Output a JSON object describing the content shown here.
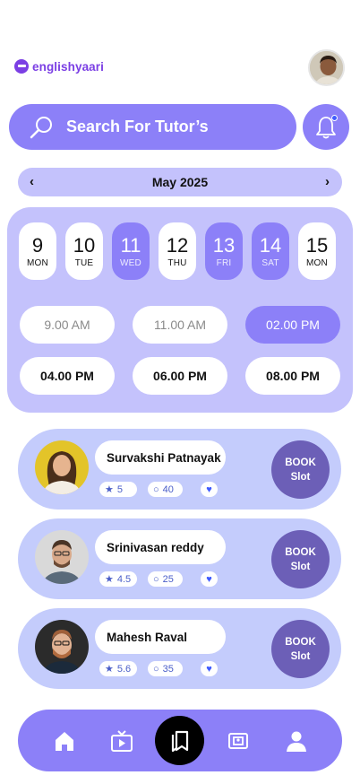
{
  "brand": {
    "name": "englishyaari",
    "color": "#7b3fe4"
  },
  "header": {
    "avatar_icon": "user-avatar"
  },
  "search": {
    "label": "Search For Tutor’s",
    "icon": "search-icon"
  },
  "notifications": {
    "icon": "bell-icon",
    "has_unread": true
  },
  "calendar": {
    "month": "May 2025",
    "prev_icon": "chevron-left-icon",
    "next_icon": "chevron-right-icon",
    "days": [
      {
        "num": "9",
        "name": "MON",
        "selected": false
      },
      {
        "num": "10",
        "name": "TUE",
        "selected": false
      },
      {
        "num": "11",
        "name": "WED",
        "selected": true
      },
      {
        "num": "12",
        "name": "THU",
        "selected": false
      },
      {
        "num": "13",
        "name": "FRI",
        "selected": true
      },
      {
        "num": "14",
        "name": "SAT",
        "selected": true
      },
      {
        "num": "15",
        "name": "MON",
        "selected": false
      }
    ],
    "times": [
      {
        "label": "9.00 AM",
        "state": "muted"
      },
      {
        "label": "11.00 AM",
        "state": "muted"
      },
      {
        "label": "02.00 PM",
        "state": "active"
      },
      {
        "label": "04.00 PM",
        "state": "normal"
      },
      {
        "label": "06.00 PM",
        "state": "normal"
      },
      {
        "label": "08.00 PM",
        "state": "normal"
      }
    ]
  },
  "tutors": [
    {
      "name": "Survakshi Patnayak",
      "rating": "5",
      "reviews": "40",
      "book_line1": "BOOK",
      "book_line2": "Slot"
    },
    {
      "name": "Srinivasan reddy",
      "rating": "4.5",
      "reviews": "25",
      "book_line1": "BOOK",
      "book_line2": "Slot"
    },
    {
      "name": "Mahesh Raval",
      "rating": "5.6",
      "reviews": "35",
      "book_line1": "BOOK",
      "book_line2": "Slot"
    }
  ],
  "bottom_nav": {
    "items": [
      "home-icon",
      "video-icon",
      "bookmark-icon",
      "gallery-icon",
      "profile-icon"
    ],
    "active": "bookmark-icon"
  },
  "colors": {
    "primary": "#8c80f8",
    "panel": "#c4c2fc",
    "card": "#c4ccfc",
    "book_button": "#6c5fb7",
    "accent_blue": "#3f5bff"
  }
}
